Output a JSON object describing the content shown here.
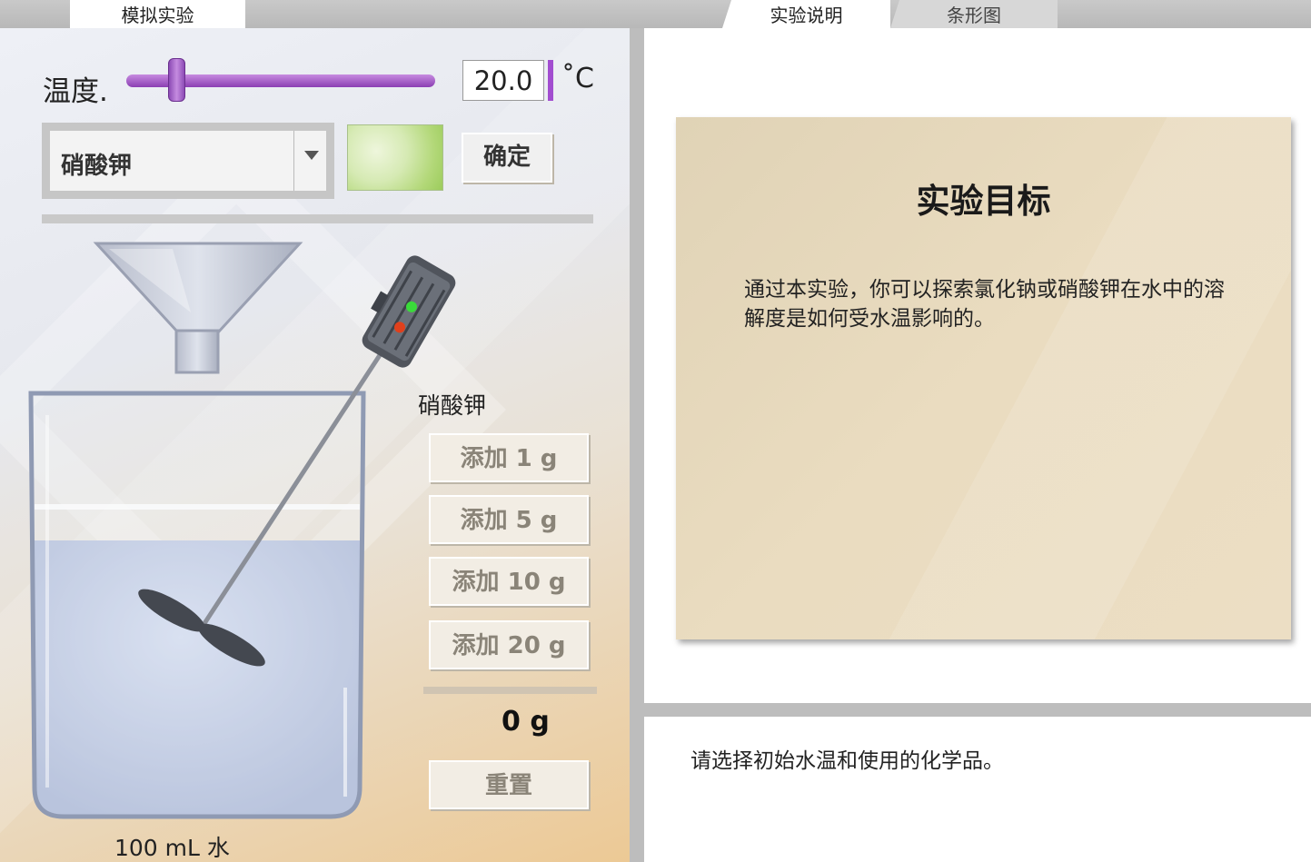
{
  "tabs": {
    "simulation": "模拟实验",
    "explanation": "实验说明",
    "bar_chart": "条形图"
  },
  "controls": {
    "temperature_label": "温度.",
    "temperature_value": "20.0",
    "temperature_unit": "˚C",
    "chemical_selected": "硝酸钾",
    "confirm_label": "确定"
  },
  "additions": {
    "title": "硝酸钾",
    "buttons": [
      "添加 1 g",
      "添加 5 g",
      "添加 10 g",
      "添加 20 g"
    ],
    "total": "0 g",
    "reset_label": "重置"
  },
  "beaker": {
    "label": "100 mL 水"
  },
  "explanation": {
    "title": "实验目标",
    "body": "通过本实验，你可以探索氯化钠或硝酸钾在水中的溶解度是如何受水温影响的。"
  },
  "status": "请选择初始水温和使用的化学品。"
}
